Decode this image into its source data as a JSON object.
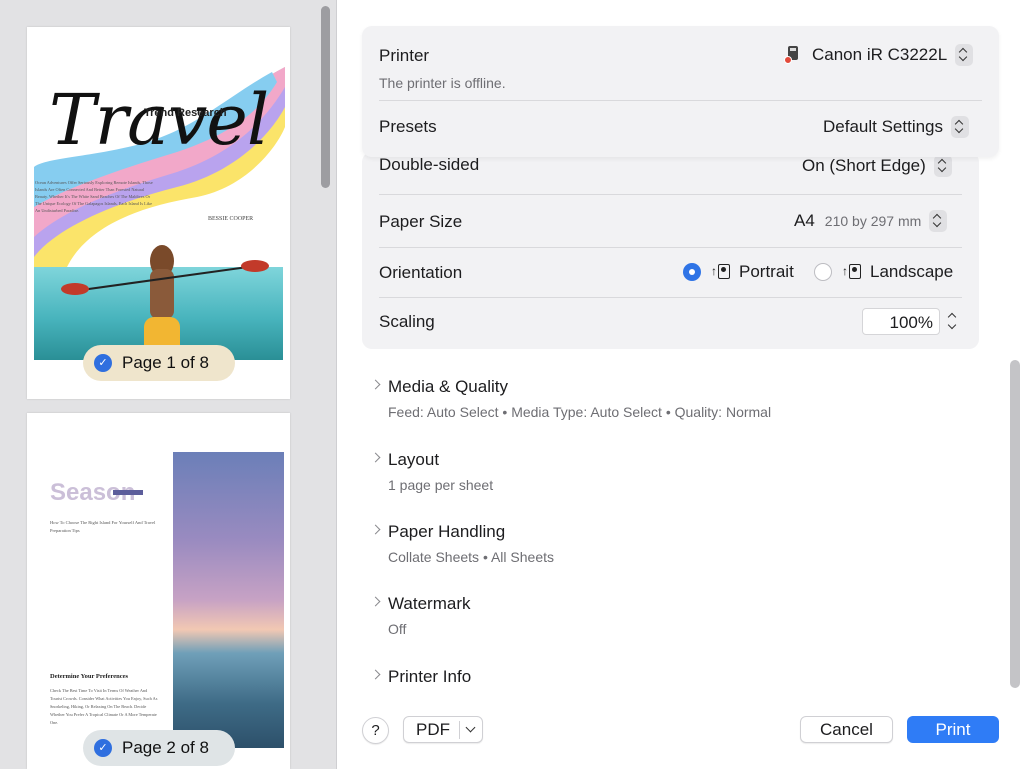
{
  "preview": {
    "page1": {
      "badge": "Page 1 of 8",
      "cover_title": "Travel",
      "cover_subtitle": "Trend Research",
      "cover_author": "BESSIE COOPER",
      "cover_body": "Ocean Adventures Offer Seriously Exploring Remote Islands, Those Islands Are Often Connected And Better Than Forested Natural Beauty. Whether It's The White Sand Beaches Of The Maldives Or The Unique Ecology Of The Galapagos Islands, Each Island Is Like An Undisturbed Paradise."
    },
    "page2": {
      "badge": "Page 2 of 8",
      "title": "Season",
      "intro": "How To Choose The Right Island For Yourself And Travel Preparation Tips",
      "heading": "Determine Your Preferences",
      "body": "Check The Best Time To Visit In Terms Of Weather And Tourist Crowds. Consider What Activities You Enjoy, Such As Snorkeling, Hiking, Or Relaxing On The Beach. Decide Whether You Prefer A Tropical Climate Or A More Temperate One."
    }
  },
  "printer": {
    "label": "Printer",
    "value": "Canon iR C3222L",
    "status": "The printer is offline."
  },
  "presets": {
    "label": "Presets",
    "value": "Default Settings"
  },
  "double_sided": {
    "label": "Double-sided",
    "value": "On (Short Edge)"
  },
  "paper_size": {
    "label": "Paper Size",
    "value": "A4",
    "dimensions": "210 by 297 mm"
  },
  "orientation": {
    "label": "Orientation",
    "portrait": "Portrait",
    "landscape": "Landscape",
    "selected": "Portrait"
  },
  "scaling": {
    "label": "Scaling",
    "value": "100%"
  },
  "sections": [
    {
      "title": "Media & Quality",
      "summary": "Feed: Auto Select • Media Type: Auto Select • Quality: Normal"
    },
    {
      "title": "Layout",
      "summary": "1 page per sheet"
    },
    {
      "title": "Paper Handling",
      "summary": "Collate Sheets • All Sheets"
    },
    {
      "title": "Watermark",
      "summary": "Off"
    },
    {
      "title": "Printer Info",
      "summary": ""
    }
  ],
  "footer": {
    "help": "?",
    "pdf": "PDF",
    "cancel": "Cancel",
    "print": "Print"
  },
  "colors": {
    "accent": "#2f7cf6",
    "printer_offline_dot": "#e34a3a"
  },
  "icons": {
    "check": "checkmark-circle-icon",
    "printer": "printer-icon",
    "stepper": "up-down-chevron-icon",
    "portrait": "portrait-orientation-icon",
    "landscape": "landscape-orientation-icon",
    "disclosure": "chevron-right-icon",
    "dropdown": "chevron-down-icon"
  }
}
